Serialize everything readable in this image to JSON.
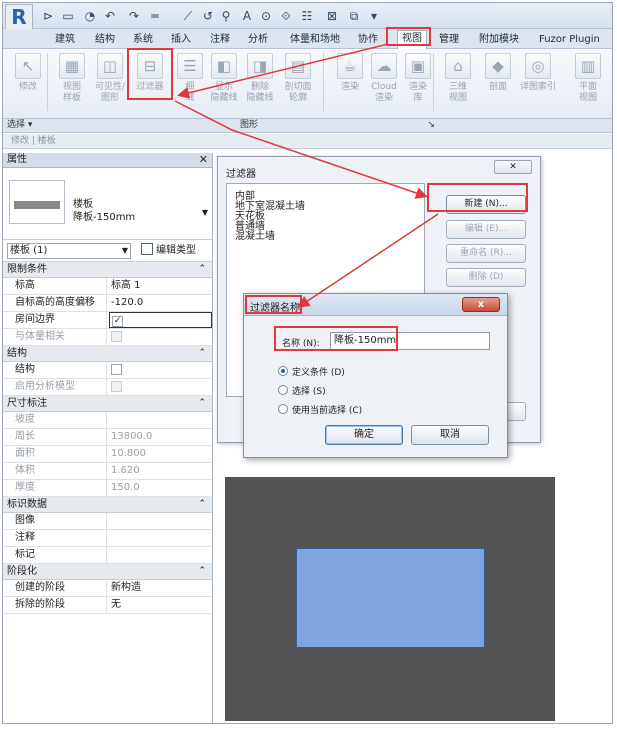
{
  "qat": {
    "logo": "R",
    "icons": [
      "open-icon",
      "save-icon",
      "sync-icon",
      "undo-icon",
      "redo-icon",
      "print-icon",
      "measure-icon",
      "dimension-icon",
      "tag-icon",
      "text-icon",
      "3d-view-icon",
      "section-icon",
      "thin-lines-icon",
      "close-windows-icon",
      "switch-windows-icon",
      "dropdown-icon"
    ],
    "icon_glyphs": [
      "⊳",
      "▭",
      "◔",
      "↶",
      "↷",
      "═",
      "⟋",
      "↺",
      "⚲",
      "A",
      "⊙",
      "⟐",
      "☷",
      "⊠",
      "⧉",
      "▾"
    ]
  },
  "tabs": [
    "建筑",
    "结构",
    "系统",
    "插入",
    "注释",
    "分析",
    "体量和场地",
    "协作",
    "视图",
    "管理",
    "附加模块",
    "Fuzor Plugin"
  ],
  "active_tab": "视图",
  "ribbon": {
    "buttons": [
      {
        "label": "修改",
        "icon": "modify-arrow-icon",
        "glyph": "↖"
      },
      {
        "label": "视图\n样板",
        "icon": "view-template-icon",
        "glyph": "▦"
      },
      {
        "label": "可见性/\n图形",
        "icon": "visibility-graphics-icon",
        "glyph": "◫"
      },
      {
        "label": "过滤器",
        "icon": "filters-icon",
        "glyph": "⊟"
      },
      {
        "label": "细\n线",
        "icon": "thin-lines-icon",
        "glyph": "☰"
      },
      {
        "label": "显示\n隐藏线",
        "icon": "show-hidden-lines-icon",
        "glyph": "◧"
      },
      {
        "label": "删除\n隐藏线",
        "icon": "remove-hidden-lines-icon",
        "glyph": "◨"
      },
      {
        "label": "剖切面\n轮廓",
        "icon": "cut-profile-icon",
        "glyph": "▤"
      },
      {
        "label": "渲染",
        "icon": "render-icon",
        "glyph": "☕"
      },
      {
        "label": "Cloud\n渲染",
        "icon": "cloud-render-icon",
        "glyph": "☁"
      },
      {
        "label": "渲染\n库",
        "icon": "render-gallery-icon",
        "glyph": "▣"
      },
      {
        "label": "三维\n视图",
        "icon": "3d-view-icon",
        "glyph": "⌂"
      },
      {
        "label": "剖面",
        "icon": "section-icon",
        "glyph": "◆"
      },
      {
        "label": "详图索引",
        "icon": "callout-icon",
        "glyph": "◎"
      },
      {
        "label": "平面\n视图",
        "icon": "plan-view-icon",
        "glyph": "▥"
      }
    ],
    "panels": {
      "select": "选择 ▾",
      "graphics": "图形",
      "graphics_corner": "↘"
    }
  },
  "subbar": "修改 | 楼板",
  "properties": {
    "header": "属性",
    "close": "✕",
    "type_name_line1": "楼板",
    "type_name_line2": "降板-150mm",
    "instance_selector": "楼板 (1)",
    "edit_type": "编辑类型",
    "sections": [
      {
        "name": "限制条件",
        "rows": [
          {
            "k": "标高",
            "v": "标高 1",
            "dis": false
          },
          {
            "k": "自标高的高度偏移",
            "v": "-120.0",
            "dis": false
          },
          {
            "k": "房间边界",
            "v": "✓",
            "checkbox": true,
            "dis": false
          },
          {
            "k": "与体量相关",
            "v": "",
            "checkbox": true,
            "dis": true
          }
        ]
      },
      {
        "name": "结构",
        "rows": [
          {
            "k": "结构",
            "v": "",
            "checkbox": true,
            "dis": false
          },
          {
            "k": "启用分析模型",
            "v": "",
            "checkbox": true,
            "dis": true
          }
        ]
      },
      {
        "name": "尺寸标注",
        "rows": [
          {
            "k": "坡度",
            "v": "",
            "dis": true
          },
          {
            "k": "周长",
            "v": "13800.0",
            "dis": true
          },
          {
            "k": "面积",
            "v": "10.800",
            "dis": true
          },
          {
            "k": "体积",
            "v": "1.620",
            "dis": true
          },
          {
            "k": "厚度",
            "v": "150.0",
            "dis": true
          }
        ]
      },
      {
        "name": "标识数据",
        "rows": [
          {
            "k": "图像",
            "v": "",
            "dis": false
          },
          {
            "k": "注释",
            "v": "",
            "dis": false
          },
          {
            "k": "标记",
            "v": "",
            "dis": false
          }
        ]
      },
      {
        "name": "阶段化",
        "rows": [
          {
            "k": "创建的阶段",
            "v": "新构造",
            "dis": false
          },
          {
            "k": "拆除的阶段",
            "v": "无",
            "dis": false
          }
        ]
      }
    ]
  },
  "filters_dialog": {
    "title": "过滤器",
    "close": "✕",
    "list": [
      "内部",
      "地下室混凝土墙",
      "天花板",
      "普通墙",
      "混凝土墙"
    ],
    "buttons": {
      "new": "新建 (N)...",
      "edit": "编辑 (E)...",
      "rename": "重命名 (R)...",
      "delete": "删除 (D)"
    }
  },
  "name_dialog": {
    "title": "过滤器名称",
    "close": "x",
    "name_label": "名称 (N):",
    "name_value": "降板-150mm",
    "options": [
      "定义条件 (D)",
      "选择 (S)",
      "使用当前选择 (C)"
    ],
    "selected_option": 0,
    "ok": "确定",
    "cancel": "取消"
  },
  "colors": {
    "highlight": "#e0383c",
    "slab": "#80a4e0",
    "canvas": "#545454"
  }
}
